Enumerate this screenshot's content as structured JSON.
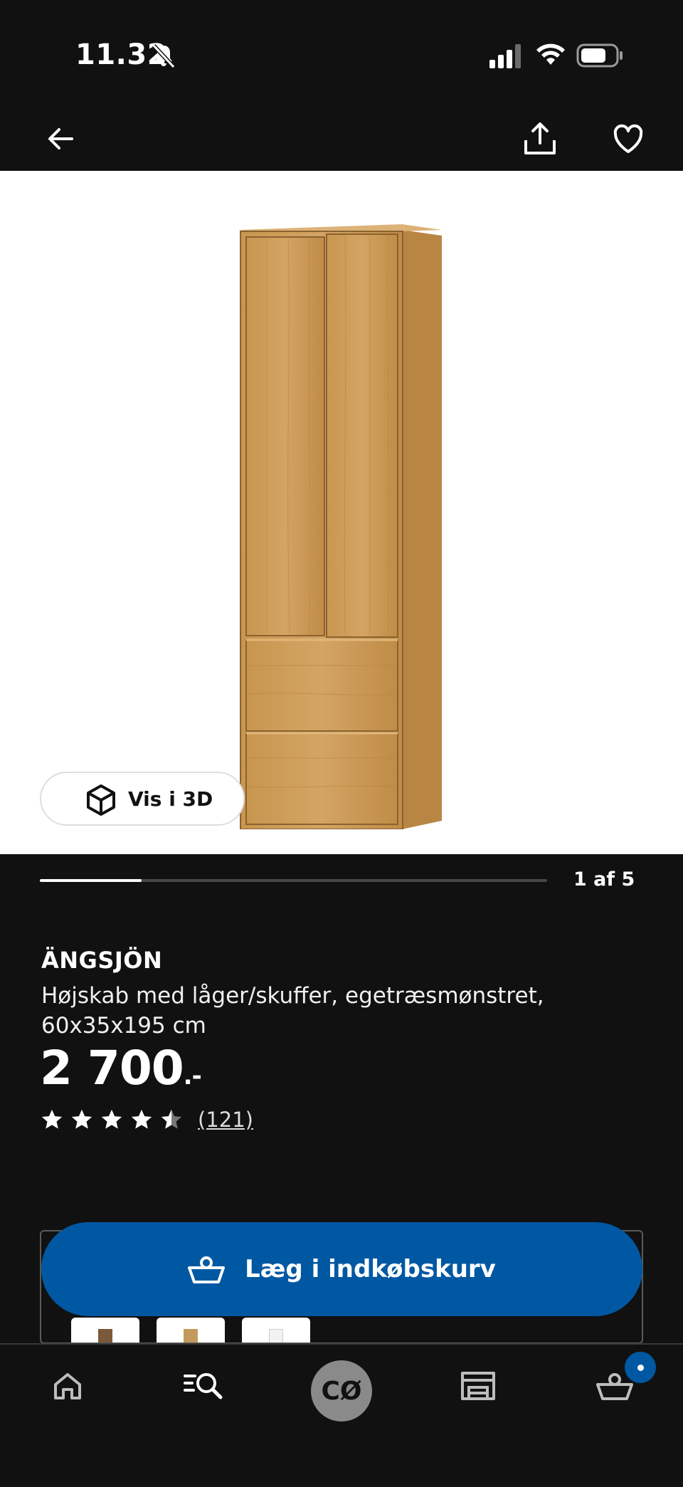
{
  "status_bar": {
    "time": "11.32"
  },
  "gallery": {
    "view_3d_label": "Vis i 3D",
    "counter": "1 af 5",
    "current_image": 1,
    "total_images": 5
  },
  "product": {
    "name": "ÄNGSJÖN",
    "description": "Højskab med låger/skuffer, egetræsmønstret, 60x35x195 cm",
    "price_main": "2 700",
    "price_suffix": ".-",
    "rating": 4.5,
    "review_count": "(121)"
  },
  "actions": {
    "add_to_cart": "Læg i indkøbskurv"
  },
  "variants": [
    {
      "color": "#7a5a3a"
    },
    {
      "color": "#c49a5c"
    },
    {
      "color": "#f2f2f2"
    }
  ],
  "tabbar": {
    "items": [
      "home",
      "search",
      "profile",
      "store",
      "cart"
    ],
    "profile_initials": "CØ"
  },
  "colors": {
    "accent": "#0058a3",
    "background": "#111111"
  }
}
